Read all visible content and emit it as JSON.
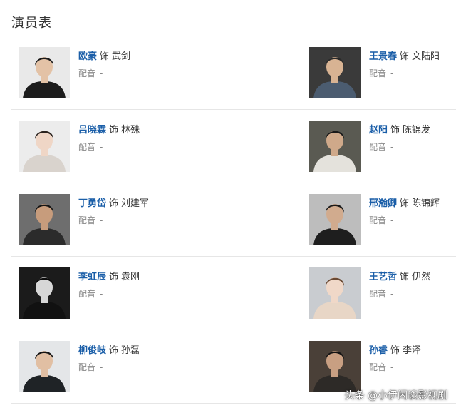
{
  "section": {
    "title": "演员表"
  },
  "connector": "饰",
  "cast": [
    {
      "actor": "欧豪",
      "role": "武剑",
      "dub_label": "配音",
      "dub_value": "-",
      "photo": {
        "bg": "#e9e9e9",
        "skin": "#e3c2a6",
        "hair": "#1b1b1b",
        "cloth": "#1c1c1c"
      }
    },
    {
      "actor": "王景春",
      "role": "文陆阳",
      "dub_label": "配音",
      "dub_value": "-",
      "photo": {
        "bg": "#3a3a3a",
        "skin": "#d8b393",
        "hair": "#2a2a2a",
        "cloth": "#4b5c70"
      }
    },
    {
      "actor": "吕晓霖",
      "role": "林殊",
      "dub_label": "配音",
      "dub_value": "-",
      "photo": {
        "bg": "#ececec",
        "skin": "#efd6c6",
        "hair": "#2b2420",
        "cloth": "#d9d3cd"
      }
    },
    {
      "actor": "赵阳",
      "role": "陈锦发",
      "dub_label": "配音",
      "dub_value": "-",
      "photo": {
        "bg": "#5a5a52",
        "skin": "#cfa98a",
        "hair": "#1a1a1a",
        "cloth": "#e4e2dc"
      }
    },
    {
      "actor": "丁勇岱",
      "role": "刘建军",
      "dub_label": "配音",
      "dub_value": "-",
      "photo": {
        "bg": "#6e6e6e",
        "skin": "#c79c7c",
        "hair": "#151515",
        "cloth": "#2b2b2b"
      }
    },
    {
      "actor": "邢瀚卿",
      "role": "陈锦辉",
      "dub_label": "配音",
      "dub_value": "-",
      "photo": {
        "bg": "#bdbdbd",
        "skin": "#d1ab8e",
        "hair": "#1a1a1a",
        "cloth": "#1e1e1e"
      }
    },
    {
      "actor": "李虹辰",
      "role": "袁刚",
      "dub_label": "配音",
      "dub_value": "-",
      "photo": {
        "bg": "#1b1b1b",
        "skin": "#d7d7d7",
        "hair": "#0c0c0c",
        "cloth": "#111111"
      }
    },
    {
      "actor": "王艺哲",
      "role": "伊然",
      "dub_label": "配音",
      "dub_value": "-",
      "photo": {
        "bg": "#c9ccd0",
        "skin": "#f0d8c8",
        "hair": "#6a4a34",
        "cloth": "#e8d6c6"
      }
    },
    {
      "actor": "柳俊岐",
      "role": "孙磊",
      "dub_label": "配音",
      "dub_value": "-",
      "photo": {
        "bg": "#e4e6e8",
        "skin": "#e1bfa3",
        "hair": "#151515",
        "cloth": "#1f2326"
      }
    },
    {
      "actor": "孙睿",
      "role": "李泽",
      "dub_label": "配音",
      "dub_value": "-",
      "photo": {
        "bg": "#4a4038",
        "skin": "#c89f82",
        "hair": "#141414",
        "cloth": "#2d2a27"
      }
    }
  ],
  "watermark": "头条 @小伊闲谈影视剧"
}
